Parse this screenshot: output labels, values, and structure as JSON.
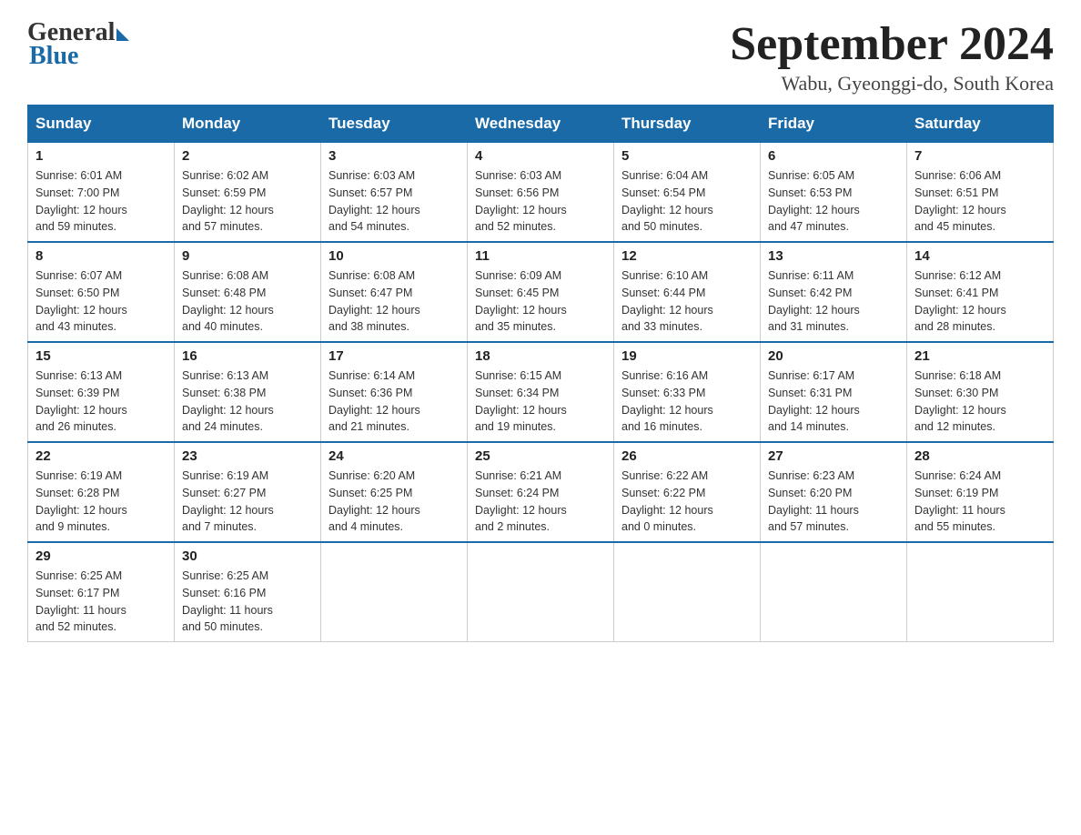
{
  "logo": {
    "general": "General",
    "blue": "Blue"
  },
  "title": {
    "month": "September 2024",
    "location": "Wabu, Gyeonggi-do, South Korea"
  },
  "days_of_week": [
    "Sunday",
    "Monday",
    "Tuesday",
    "Wednesday",
    "Thursday",
    "Friday",
    "Saturday"
  ],
  "weeks": [
    [
      {
        "day": "1",
        "sunrise": "6:01 AM",
        "sunset": "7:00 PM",
        "daylight": "12 hours and 59 minutes."
      },
      {
        "day": "2",
        "sunrise": "6:02 AM",
        "sunset": "6:59 PM",
        "daylight": "12 hours and 57 minutes."
      },
      {
        "day": "3",
        "sunrise": "6:03 AM",
        "sunset": "6:57 PM",
        "daylight": "12 hours and 54 minutes."
      },
      {
        "day": "4",
        "sunrise": "6:03 AM",
        "sunset": "6:56 PM",
        "daylight": "12 hours and 52 minutes."
      },
      {
        "day": "5",
        "sunrise": "6:04 AM",
        "sunset": "6:54 PM",
        "daylight": "12 hours and 50 minutes."
      },
      {
        "day": "6",
        "sunrise": "6:05 AM",
        "sunset": "6:53 PM",
        "daylight": "12 hours and 47 minutes."
      },
      {
        "day": "7",
        "sunrise": "6:06 AM",
        "sunset": "6:51 PM",
        "daylight": "12 hours and 45 minutes."
      }
    ],
    [
      {
        "day": "8",
        "sunrise": "6:07 AM",
        "sunset": "6:50 PM",
        "daylight": "12 hours and 43 minutes."
      },
      {
        "day": "9",
        "sunrise": "6:08 AM",
        "sunset": "6:48 PM",
        "daylight": "12 hours and 40 minutes."
      },
      {
        "day": "10",
        "sunrise": "6:08 AM",
        "sunset": "6:47 PM",
        "daylight": "12 hours and 38 minutes."
      },
      {
        "day": "11",
        "sunrise": "6:09 AM",
        "sunset": "6:45 PM",
        "daylight": "12 hours and 35 minutes."
      },
      {
        "day": "12",
        "sunrise": "6:10 AM",
        "sunset": "6:44 PM",
        "daylight": "12 hours and 33 minutes."
      },
      {
        "day": "13",
        "sunrise": "6:11 AM",
        "sunset": "6:42 PM",
        "daylight": "12 hours and 31 minutes."
      },
      {
        "day": "14",
        "sunrise": "6:12 AM",
        "sunset": "6:41 PM",
        "daylight": "12 hours and 28 minutes."
      }
    ],
    [
      {
        "day": "15",
        "sunrise": "6:13 AM",
        "sunset": "6:39 PM",
        "daylight": "12 hours and 26 minutes."
      },
      {
        "day": "16",
        "sunrise": "6:13 AM",
        "sunset": "6:38 PM",
        "daylight": "12 hours and 24 minutes."
      },
      {
        "day": "17",
        "sunrise": "6:14 AM",
        "sunset": "6:36 PM",
        "daylight": "12 hours and 21 minutes."
      },
      {
        "day": "18",
        "sunrise": "6:15 AM",
        "sunset": "6:34 PM",
        "daylight": "12 hours and 19 minutes."
      },
      {
        "day": "19",
        "sunrise": "6:16 AM",
        "sunset": "6:33 PM",
        "daylight": "12 hours and 16 minutes."
      },
      {
        "day": "20",
        "sunrise": "6:17 AM",
        "sunset": "6:31 PM",
        "daylight": "12 hours and 14 minutes."
      },
      {
        "day": "21",
        "sunrise": "6:18 AM",
        "sunset": "6:30 PM",
        "daylight": "12 hours and 12 minutes."
      }
    ],
    [
      {
        "day": "22",
        "sunrise": "6:19 AM",
        "sunset": "6:28 PM",
        "daylight": "12 hours and 9 minutes."
      },
      {
        "day": "23",
        "sunrise": "6:19 AM",
        "sunset": "6:27 PM",
        "daylight": "12 hours and 7 minutes."
      },
      {
        "day": "24",
        "sunrise": "6:20 AM",
        "sunset": "6:25 PM",
        "daylight": "12 hours and 4 minutes."
      },
      {
        "day": "25",
        "sunrise": "6:21 AM",
        "sunset": "6:24 PM",
        "daylight": "12 hours and 2 minutes."
      },
      {
        "day": "26",
        "sunrise": "6:22 AM",
        "sunset": "6:22 PM",
        "daylight": "12 hours and 0 minutes."
      },
      {
        "day": "27",
        "sunrise": "6:23 AM",
        "sunset": "6:20 PM",
        "daylight": "11 hours and 57 minutes."
      },
      {
        "day": "28",
        "sunrise": "6:24 AM",
        "sunset": "6:19 PM",
        "daylight": "11 hours and 55 minutes."
      }
    ],
    [
      {
        "day": "29",
        "sunrise": "6:25 AM",
        "sunset": "6:17 PM",
        "daylight": "11 hours and 52 minutes."
      },
      {
        "day": "30",
        "sunrise": "6:25 AM",
        "sunset": "6:16 PM",
        "daylight": "11 hours and 50 minutes."
      },
      null,
      null,
      null,
      null,
      null
    ]
  ],
  "labels": {
    "sunrise": "Sunrise:",
    "sunset": "Sunset:",
    "daylight": "Daylight:"
  }
}
